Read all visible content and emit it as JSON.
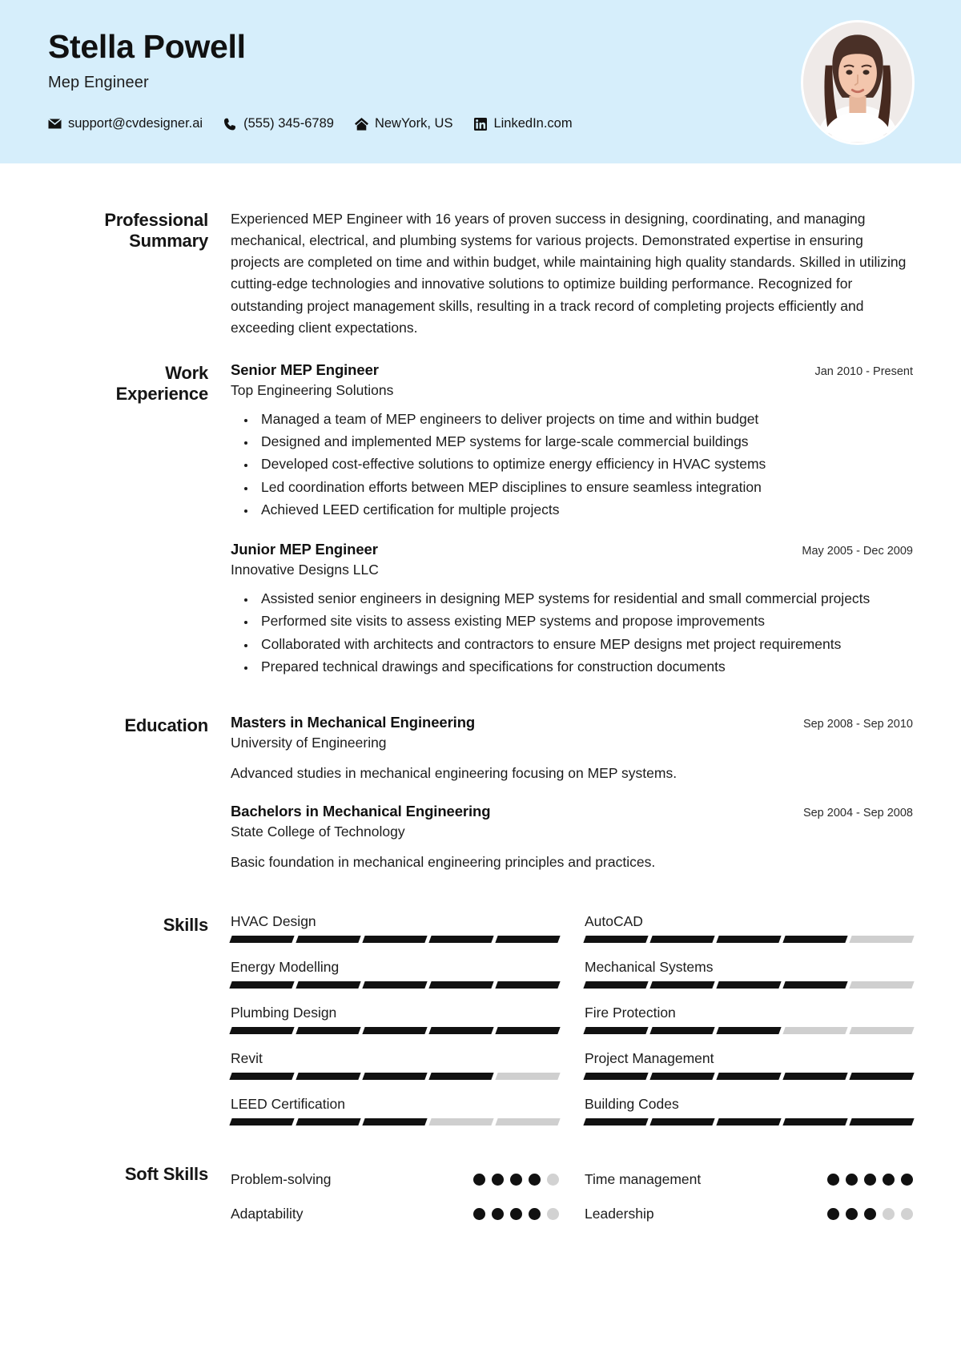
{
  "header": {
    "name": "Stella Powell",
    "role": "Mep Engineer",
    "accent_color": "#d6eefb",
    "contacts": [
      {
        "icon": "envelope-icon",
        "label": "support@cvdesigner.ai"
      },
      {
        "icon": "phone-icon",
        "label": "(555) 345-6789"
      },
      {
        "icon": "home-icon",
        "label": "NewYork, US"
      },
      {
        "icon": "linkedin-icon",
        "label": "LinkedIn.com"
      }
    ],
    "avatar_alt": "profile-photo"
  },
  "summary": {
    "title_line1": "Professional",
    "title_line2": "Summary",
    "text": "Experienced MEP Engineer with 16 years of proven success in designing, coordinating, and managing mechanical, electrical, and plumbing systems for various projects. Demonstrated expertise in ensuring projects are completed on time and within budget, while maintaining high quality standards. Skilled in utilizing cutting-edge technologies and innovative solutions to optimize building performance. Recognized for outstanding project management skills, resulting in a track record of completing projects efficiently and exceeding client expectations."
  },
  "experience": {
    "title_line1": "Work",
    "title_line2": "Experience",
    "entries": [
      {
        "title": "Senior MEP Engineer",
        "organization": "Top Engineering Solutions",
        "date": "Jan 2010 - Present",
        "bullets": [
          "Managed a team of MEP engineers to deliver projects on time and within budget",
          "Designed and implemented MEP systems for large-scale commercial buildings",
          "Developed cost-effective solutions to optimize energy efficiency in HVAC systems",
          "Led coordination efforts between MEP disciplines to ensure seamless integration",
          "Achieved LEED certification for multiple projects"
        ]
      },
      {
        "title": "Junior MEP Engineer",
        "organization": "Innovative Designs LLC",
        "date": "May 2005 - Dec 2009",
        "bullets": [
          "Assisted senior engineers in designing MEP systems for residential and small commercial projects",
          "Performed site visits to assess existing MEP systems and propose improvements",
          "Collaborated with architects and contractors to ensure MEP designs met project requirements",
          "Prepared technical drawings and specifications for construction documents"
        ]
      }
    ]
  },
  "education": {
    "title": "Education",
    "entries": [
      {
        "degree": "Masters in Mechanical Engineering",
        "school": "University of Engineering",
        "date": "Sep 2008 - Sep 2010",
        "description": "Advanced studies in mechanical engineering focusing on MEP systems."
      },
      {
        "degree": "Bachelors in Mechanical Engineering",
        "school": "State College of Technology",
        "date": "Sep 2004 - Sep 2008",
        "description": "Basic foundation in mechanical engineering principles and practices."
      }
    ]
  },
  "skills": {
    "title": "Skills",
    "max_level": 5,
    "items": [
      {
        "name": "HVAC Design",
        "level": 5
      },
      {
        "name": "AutoCAD",
        "level": 4
      },
      {
        "name": "Energy Modelling",
        "level": 5
      },
      {
        "name": "Mechanical Systems",
        "level": 4
      },
      {
        "name": "Plumbing Design",
        "level": 5
      },
      {
        "name": "Fire Protection",
        "level": 3
      },
      {
        "name": "Revit",
        "level": 4
      },
      {
        "name": "Project Management",
        "level": 5
      },
      {
        "name": "LEED Certification",
        "level": 3
      },
      {
        "name": "Building Codes",
        "level": 5
      }
    ]
  },
  "soft_skills": {
    "title": "Soft Skills",
    "max_level": 5,
    "items": [
      {
        "name": "Problem-solving",
        "level": 4
      },
      {
        "name": "Time management",
        "level": 5
      },
      {
        "name": "Adaptability",
        "level": 4
      },
      {
        "name": "Leadership",
        "level": 3
      }
    ]
  }
}
